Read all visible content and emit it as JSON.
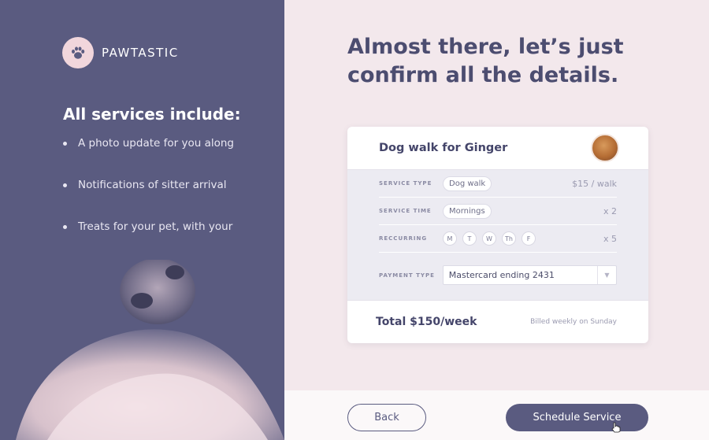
{
  "brand": {
    "name": "PAWTASTIC",
    "icon": "paw-icon"
  },
  "sidebar": {
    "heading": "All services include:",
    "features": [
      "A photo update for you along",
      "Notifications of sitter arrival",
      "Treats for your pet, with your"
    ]
  },
  "headline": "Almost there, let’s just confirm all the details.",
  "card": {
    "title": "Dog walk for Ginger",
    "rows": {
      "service_type": {
        "label": "SERVICE TYPE",
        "chip": "Dog walk",
        "value": "$15 / walk"
      },
      "service_time": {
        "label": "SERVICE TIME",
        "chip": "Mornings",
        "value": "x 2"
      },
      "recurring": {
        "label": "RECCURRING",
        "days": [
          "M",
          "T",
          "W",
          "Th",
          "F"
        ],
        "value": "x 5"
      },
      "payment": {
        "label": "PAYMENT TYPE",
        "selected": "Mastercard ending 2431"
      }
    },
    "total": "Total $150/week",
    "billing_note": "Billed weekly on Sunday"
  },
  "actions": {
    "back": "Back",
    "schedule": "Schedule Service"
  },
  "colors": {
    "primary": "#5a5b80",
    "background": "#f3e8ec",
    "accent_pink": "#f1d6dc"
  }
}
